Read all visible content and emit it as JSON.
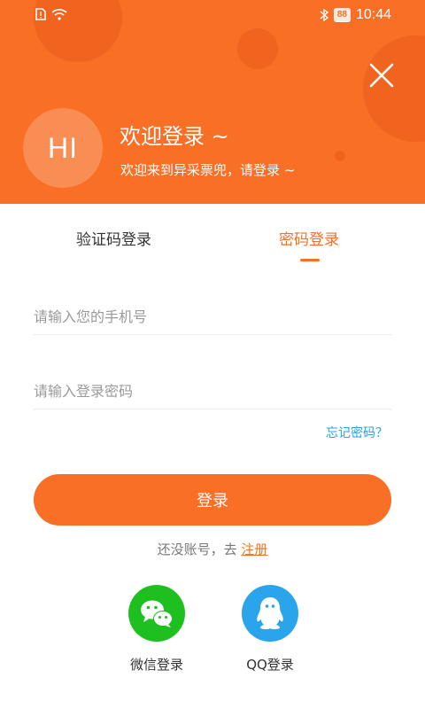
{
  "status_bar": {
    "time": "10:44",
    "battery": "88",
    "icons": [
      "sim-alert-icon",
      "wifi-icon",
      "bluetooth-icon",
      "battery-icon"
    ]
  },
  "header": {
    "avatar_text": "HI",
    "title": "欢迎登录 ~",
    "subtitle": "欢迎来到异采票兜，请登录 ~",
    "close_icon": "close-icon"
  },
  "tabs": [
    {
      "label": "验证码登录",
      "active": false
    },
    {
      "label": "密码登录",
      "active": true
    }
  ],
  "form": {
    "phone_placeholder": "请输入您的手机号",
    "password_placeholder": "请输入登录密码",
    "forgot_label": "忘记密码？",
    "login_label": "登录"
  },
  "register": {
    "prompt": "还没账号，去",
    "link": "注册"
  },
  "social": {
    "wechat_label": "微信登录",
    "qq_label": "QQ登录"
  },
  "colors": {
    "accent": "#f86f25",
    "link": "#2aa0e2",
    "wechat": "#1ec020",
    "qq": "#2aa4eb"
  }
}
